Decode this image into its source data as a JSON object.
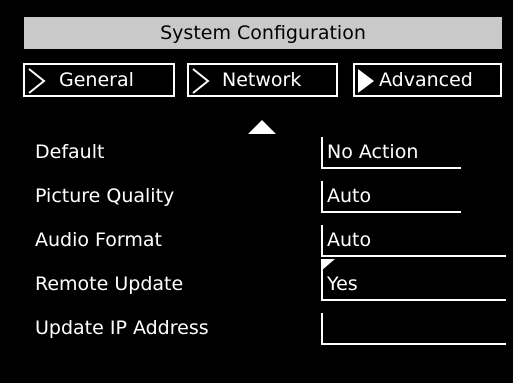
{
  "header": {
    "title": "System Configuration"
  },
  "tabs": [
    {
      "label": "General"
    },
    {
      "label": "Network"
    },
    {
      "label": "Advanced"
    }
  ],
  "settings": [
    {
      "label": "Default",
      "value": "No Action"
    },
    {
      "label": "Picture Quality",
      "value": "Auto"
    },
    {
      "label": "Audio Format",
      "value": "Auto"
    },
    {
      "label": "Remote Update",
      "value": "Yes"
    },
    {
      "label": "Update IP Address",
      "value": ""
    }
  ],
  "icons": {
    "tab_arrow": "chevron-right-icon",
    "tab_arrow_active": "solid-triangle-right-icon",
    "scroll_up": "triangle-up-icon",
    "focus_marker": "corner-triangle-icon"
  },
  "colors": {
    "background": "#000000",
    "title_bar": "#c9c9c9",
    "foreground": "#ffffff",
    "title_text": "#000000"
  }
}
